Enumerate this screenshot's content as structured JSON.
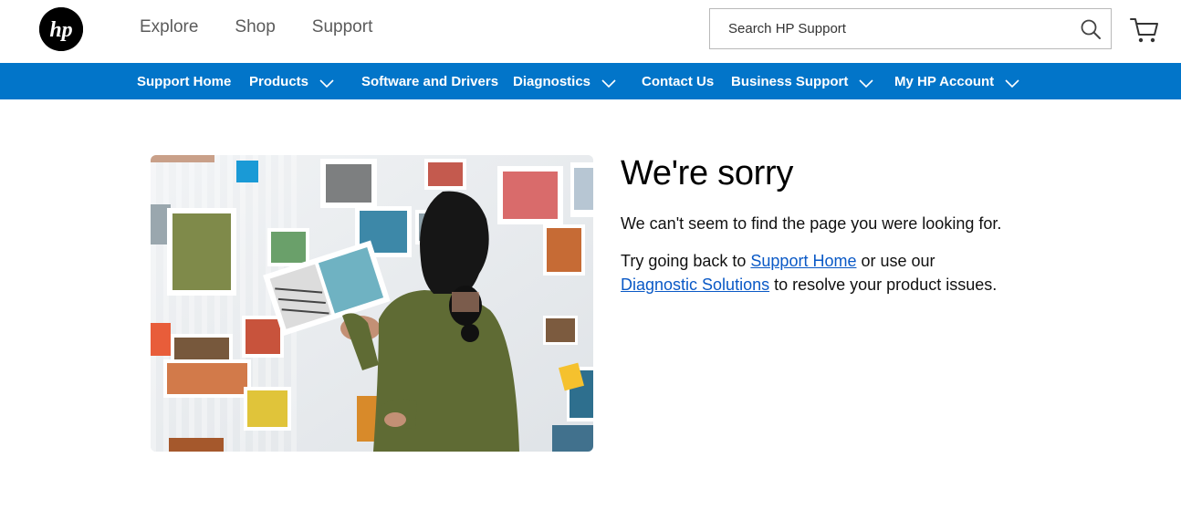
{
  "header": {
    "nav": [
      "Explore",
      "Shop",
      "Support"
    ],
    "search_placeholder": "Search HP Support"
  },
  "navbar": {
    "items": [
      {
        "label": "Support Home",
        "dropdown": false
      },
      {
        "label": "Products",
        "dropdown": true
      },
      {
        "label": "Software and Drivers",
        "dropdown": false
      },
      {
        "label": "Diagnostics",
        "dropdown": true
      },
      {
        "label": "Contact Us",
        "dropdown": false
      },
      {
        "label": "Business Support",
        "dropdown": true
      },
      {
        "label": "My HP Account",
        "dropdown": true
      }
    ]
  },
  "main": {
    "title": "We're sorry",
    "message": "We can't seem to find the page you were looking for.",
    "suggestion_prefix": "Try going back to ",
    "support_home_link": "Support Home",
    "suggestion_middle": " or use our ",
    "diagnostic_link": "Diagnostic Solutions",
    "suggestion_suffix": " to resolve your product issues."
  },
  "colors": {
    "nav_blue": "#0275c9",
    "link_blue": "#0a59c6"
  },
  "icons": {
    "logo": "hp-logo",
    "search": "search-icon",
    "cart": "cart-icon",
    "dropdown": "chevron-down-icon"
  }
}
